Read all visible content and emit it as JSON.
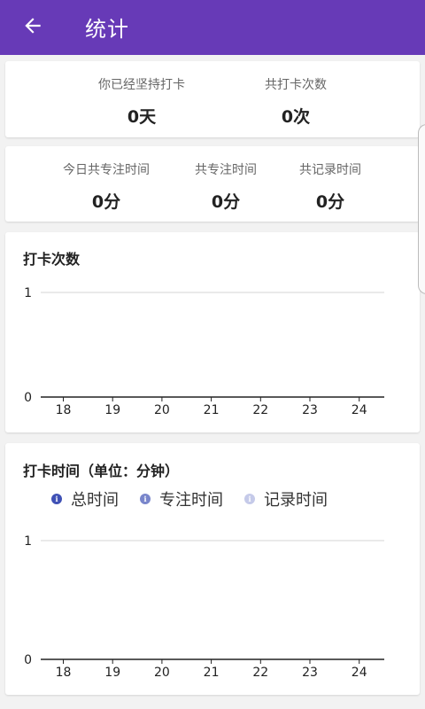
{
  "appbar": {
    "title": "统计",
    "back_icon": "arrow-back-icon",
    "color": "#673ab7"
  },
  "summary": {
    "days_label": "你已经坚持打卡",
    "days_value": "0天",
    "count_label": "共打卡次数",
    "count_value": "0次"
  },
  "focus": {
    "today_label": "今日共专注时间",
    "today_value": "0分",
    "total_label": "共专注时间",
    "total_value": "0分",
    "record_label": "共记录时间",
    "record_value": "0分"
  },
  "charts": {
    "checkin_title": "打卡次数",
    "time_title": "打卡时间（单位：分钟）",
    "legend": [
      {
        "label": "总时间",
        "color": "#3f51b5"
      },
      {
        "label": "专注时间",
        "color": "#7986cb"
      },
      {
        "label": "记录时间",
        "color": "#c5cae9"
      }
    ]
  },
  "chart_data": [
    {
      "type": "bar",
      "title": "打卡次数",
      "categories": [
        "18",
        "19",
        "20",
        "21",
        "22",
        "23",
        "24"
      ],
      "series": [
        {
          "values": [
            0,
            0,
            0,
            0,
            0,
            0,
            0
          ]
        }
      ],
      "ylim": [
        0,
        1
      ],
      "yticks": [
        "0",
        "1"
      ],
      "grid": true
    },
    {
      "type": "bar",
      "title": "打卡时间（单位：分钟）",
      "categories": [
        "18",
        "19",
        "20",
        "21",
        "22",
        "23",
        "24"
      ],
      "series": [
        {
          "name": "总时间",
          "values": [
            0,
            0,
            0,
            0,
            0,
            0,
            0
          ]
        },
        {
          "name": "专注时间",
          "values": [
            0,
            0,
            0,
            0,
            0,
            0,
            0
          ]
        },
        {
          "name": "记录时间",
          "values": [
            0,
            0,
            0,
            0,
            0,
            0,
            0
          ]
        }
      ],
      "ylim": [
        0,
        1
      ],
      "yticks": [
        "0",
        "1"
      ],
      "grid": true,
      "legend": "top"
    }
  ]
}
